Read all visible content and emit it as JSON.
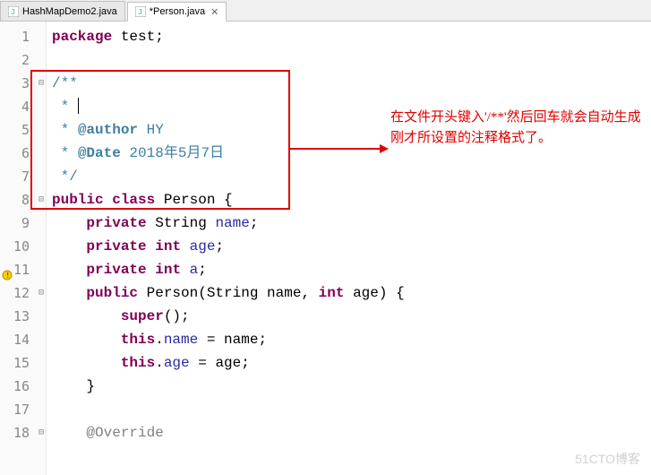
{
  "tabs": [
    {
      "label": "HashMapDemo2.java",
      "active": false
    },
    {
      "label": "*Person.java",
      "active": true
    }
  ],
  "lines": {
    "l1": {
      "num": "1",
      "kw1": "package",
      "rest": " test;"
    },
    "l2": {
      "num": "2"
    },
    "l3": {
      "num": "3",
      "comment": "/**"
    },
    "l4": {
      "num": "4",
      "comment": " * "
    },
    "l5": {
      "num": "5",
      "star": " * ",
      "tag": "@author",
      "val": " HY"
    },
    "l6": {
      "num": "6",
      "star": " * ",
      "tag": "@Date",
      "val": " 2018年5月7日"
    },
    "l7": {
      "num": "7",
      "comment": " */"
    },
    "l8": {
      "num": "8",
      "kw1": "public",
      "kw2": "class",
      "rest": " Person {"
    },
    "l9": {
      "num": "9",
      "kw1": "private",
      "type": " String ",
      "field": "name",
      "semi": ";"
    },
    "l10": {
      "num": "10",
      "kw1": "private",
      "kw2": "int",
      "field": "age",
      "semi": ";"
    },
    "l11": {
      "num": "11",
      "kw1": "private",
      "kw2": "int",
      "field": "a",
      "semi": ";"
    },
    "l12": {
      "num": "12",
      "kw1": "public",
      "name": " Person(String name, ",
      "kw2": "int",
      "rest": " age) {"
    },
    "l13": {
      "num": "13",
      "kw1": "super",
      "rest": "();"
    },
    "l14": {
      "num": "14",
      "kw1": "this",
      "dot": ".",
      "field": "name",
      "rest": " = name;"
    },
    "l15": {
      "num": "15",
      "kw1": "this",
      "dot": ".",
      "field": "age",
      "rest": " = age;"
    },
    "l16": {
      "num": "16",
      "rest": "}"
    },
    "l17": {
      "num": "17"
    },
    "l18": {
      "num": "18",
      "anno": "@Override"
    }
  },
  "annotation": "在文件开头键入'/**'然后回车就会自动生成刚才所设置的注释格式了。",
  "watermark": "51CTO博客"
}
